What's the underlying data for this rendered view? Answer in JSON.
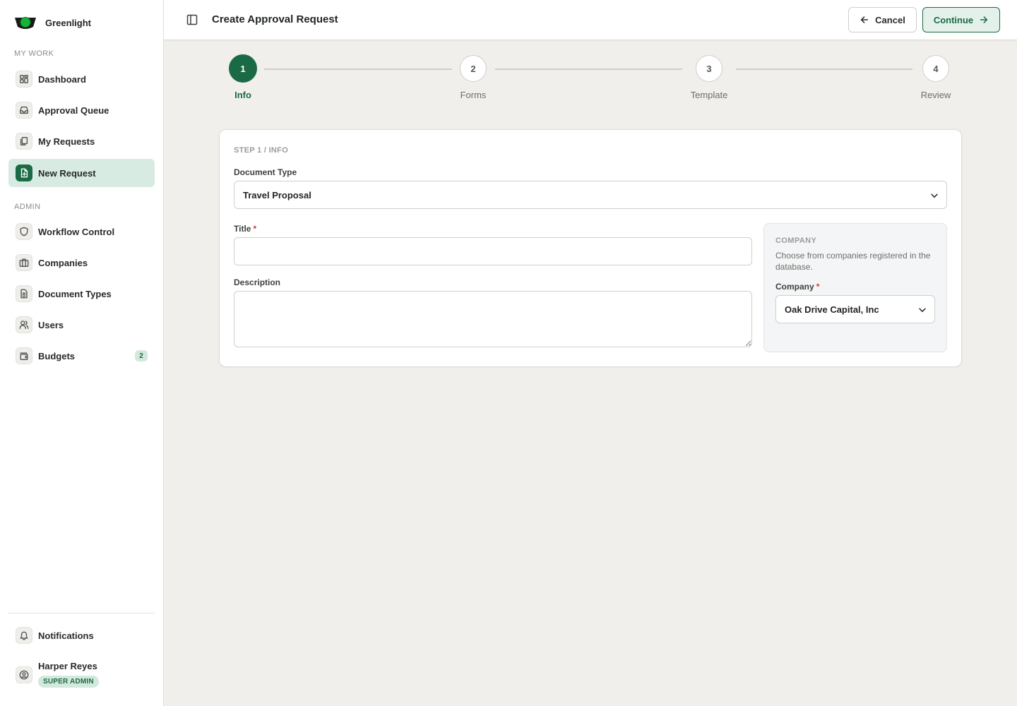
{
  "brand": {
    "name": "Greenlight"
  },
  "sidebar": {
    "sections": {
      "my_work": "MY WORK",
      "admin": "ADMIN"
    },
    "my_work_items": [
      {
        "label": "Dashboard",
        "icon": "dashboard-icon"
      },
      {
        "label": "Approval Queue",
        "icon": "inbox-icon"
      },
      {
        "label": "My Requests",
        "icon": "copy-icon"
      },
      {
        "label": "New Request",
        "icon": "file-plus-icon",
        "active": true
      }
    ],
    "admin_items": [
      {
        "label": "Workflow Control",
        "icon": "shield-icon"
      },
      {
        "label": "Companies",
        "icon": "briefcase-icon"
      },
      {
        "label": "Document Types",
        "icon": "document-icon"
      },
      {
        "label": "Users",
        "icon": "users-icon"
      },
      {
        "label": "Budgets",
        "icon": "wallet-icon",
        "badge": "2"
      }
    ],
    "notifications": {
      "label": "Notifications",
      "icon": "bell-icon"
    },
    "user": {
      "name": "Harper Reyes",
      "role": "SUPER ADMIN"
    }
  },
  "header": {
    "title": "Create Approval Request",
    "cancel_label": "Cancel",
    "continue_label": "Continue"
  },
  "stepper": {
    "steps": [
      {
        "number": "1",
        "label": "Info",
        "active": true
      },
      {
        "number": "2",
        "label": "Forms"
      },
      {
        "number": "3",
        "label": "Template"
      },
      {
        "number": "4",
        "label": "Review"
      }
    ]
  },
  "form": {
    "step_caption": "STEP 1 / INFO",
    "document_type": {
      "label": "Document Type",
      "value": "Travel Proposal"
    },
    "title": {
      "label": "Title",
      "required_mark": "*",
      "value": ""
    },
    "description": {
      "label": "Description",
      "value": ""
    },
    "company_panel": {
      "heading": "COMPANY",
      "description": "Choose from companies registered in the database.",
      "field_label": "Company",
      "required_mark": "*",
      "value": "Oak Drive Capital, Inc"
    }
  },
  "colors": {
    "accent": "#1a6b45",
    "accent_light": "#d8ebe2",
    "page_background": "#f0efeb",
    "required": "#d23b3b"
  }
}
